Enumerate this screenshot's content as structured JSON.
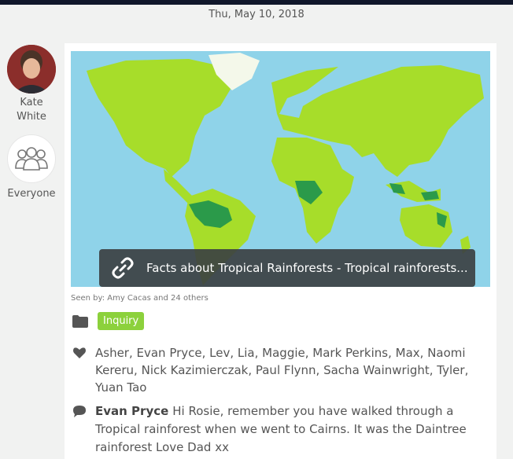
{
  "header": {
    "date": "Thu, May 10, 2018"
  },
  "author": {
    "name_line1": "Kate",
    "name_line2": "White",
    "avatar_icon": "profile-photo"
  },
  "audience": {
    "label": "Everyone",
    "icon": "group-icon"
  },
  "post": {
    "link_title": "Facts about Tropical Rainforests - Tropical rainforests...",
    "seen_by": "Seen by: Amy Cacas and 24 others",
    "tag": "Inquiry",
    "likes": "Asher, Evan Pryce, Lev, Lia, Maggie, Mark Perkins, Max, Naomi Kereru, Nick Kazimierczak, Paul Flynn, Sacha Wainwright, Tyler, Yuan Tao",
    "comment": {
      "author": "Evan Pryce",
      "text": "Hi Rosie, remember you have walked through a Tropical rainforest  when we went to Cairns. It was the Daintree rainforest Love Dad xx"
    }
  },
  "colors": {
    "ocean": "#8fd3e9",
    "land": "#a7dd2a",
    "rainforest": "#2b9a4a",
    "tag": "#8cd13c"
  }
}
